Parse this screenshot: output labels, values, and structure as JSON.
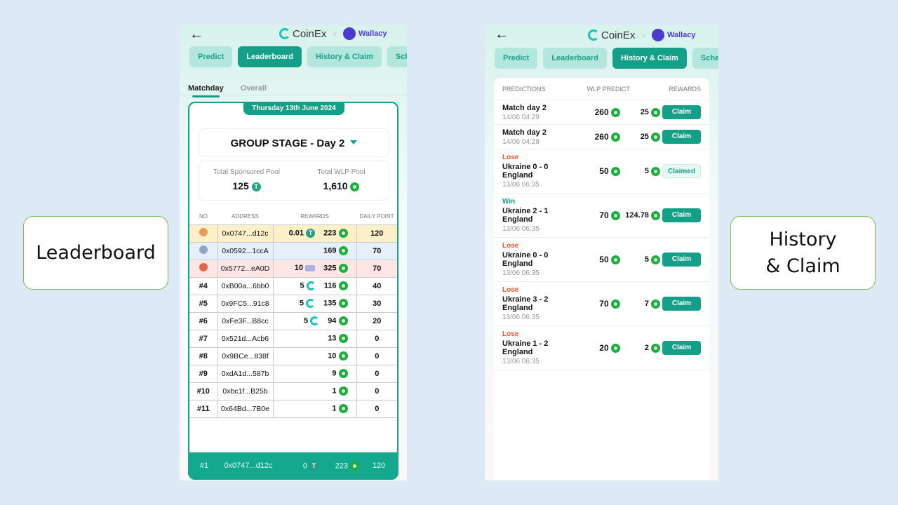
{
  "labels": {
    "left": "Leaderboard",
    "right": "History & Claim"
  },
  "brand": {
    "coinex": "CoinEx",
    "separator": "×",
    "wallacy": "Wallacy"
  },
  "colors": {
    "accent": "#14a088",
    "win": "#14a088",
    "lose": "#e4572e"
  },
  "nav_tabs": [
    "Predict",
    "Leaderboard",
    "History & Claim",
    "Schedule"
  ],
  "leaderboard": {
    "subtabs": [
      "Matchday",
      "Overall"
    ],
    "date": "Thursday 13th June 2024",
    "stage": "GROUP STAGE - Day 2",
    "sponsored_label": "Total Sponsored Pool",
    "sponsored_value": "125",
    "wlp_label": "Total WLP Pool",
    "wlp_value": "1,610",
    "headers": [
      "NO",
      "ADDRESS",
      "REWARDS",
      "DAILY POINT"
    ],
    "rows": [
      {
        "no": "",
        "medal": "gold",
        "address": "0x0747...d12c",
        "sponsor": "0.01",
        "sponsor_icon": "tether",
        "reward": "223",
        "points": "120",
        "bg": "#fdf0c8"
      },
      {
        "no": "",
        "medal": "silver",
        "address": "0x0592...1ccA",
        "sponsor": "",
        "sponsor_icon": "",
        "reward": "169",
        "points": "70",
        "bg": "#e6f0fa"
      },
      {
        "no": "",
        "medal": "bronze",
        "address": "0x5772...eA0D",
        "sponsor": "10",
        "sponsor_icon": "ticket",
        "reward": "325",
        "points": "70",
        "bg": "#fde6e4"
      },
      {
        "no": "#4",
        "address": "0xB00a...6bb0",
        "sponsor": "5",
        "sponsor_icon": "coinex",
        "reward": "116",
        "points": "40"
      },
      {
        "no": "#5",
        "address": "0x9FC5...91c8",
        "sponsor": "5",
        "sponsor_icon": "coinex",
        "reward": "135",
        "points": "30"
      },
      {
        "no": "#6",
        "address": "0xFe3F...B8cc",
        "sponsor": "5",
        "sponsor_icon": "coinex",
        "reward": "94",
        "points": "20"
      },
      {
        "no": "#7",
        "address": "0x521d...Acb6",
        "sponsor": "",
        "sponsor_icon": "",
        "reward": "13",
        "points": "0"
      },
      {
        "no": "#8",
        "address": "0x9BCe...838f",
        "sponsor": "",
        "sponsor_icon": "",
        "reward": "10",
        "points": "0"
      },
      {
        "no": "#9",
        "address": "0xdA1d...587b",
        "sponsor": "",
        "sponsor_icon": "",
        "reward": "9",
        "points": "0"
      },
      {
        "no": "#10",
        "address": "0xbc1f...B25b",
        "sponsor": "",
        "sponsor_icon": "",
        "reward": "1",
        "points": "0"
      },
      {
        "no": "#11",
        "address": "0x64Bd...7B0e",
        "sponsor": "",
        "sponsor_icon": "",
        "reward": "1",
        "points": "0"
      }
    ],
    "footer": {
      "no": "#1",
      "address": "0x0747...d12c",
      "sponsor": "0",
      "reward": "223",
      "points": "120"
    }
  },
  "history": {
    "headers": [
      "PREDICTIONS",
      "WLP PREDICT",
      "REWARDS"
    ],
    "rows": [
      {
        "result": "",
        "title": "Match day 2",
        "time": "14/06 04:29",
        "predict": "260",
        "reward": "25",
        "action": "Claim"
      },
      {
        "result": "",
        "title": "Match day 2",
        "time": "14/06 04:28",
        "predict": "260",
        "reward": "25",
        "action": "Claim"
      },
      {
        "result": "Lose",
        "title": "Ukraine 0 - 0 England",
        "time": "13/06 06:35",
        "predict": "50",
        "reward": "5",
        "action": "Claimed"
      },
      {
        "result": "Win",
        "title": "Ukraine 2 - 1 England",
        "time": "13/06 06:35",
        "predict": "70",
        "reward": "124.78",
        "action": "Claim"
      },
      {
        "result": "Lose",
        "title": "Ukraine 0 - 0 England",
        "time": "13/06 06:35",
        "predict": "50",
        "reward": "5",
        "action": "Claim"
      },
      {
        "result": "Lose",
        "title": "Ukraine 3 - 2 England",
        "time": "13/06 06:35",
        "predict": "70",
        "reward": "7",
        "action": "Claim"
      },
      {
        "result": "Lose",
        "title": "Ukraine 1 - 2 England",
        "time": "13/06 06:35",
        "predict": "20",
        "reward": "2",
        "action": "Claim"
      }
    ]
  }
}
